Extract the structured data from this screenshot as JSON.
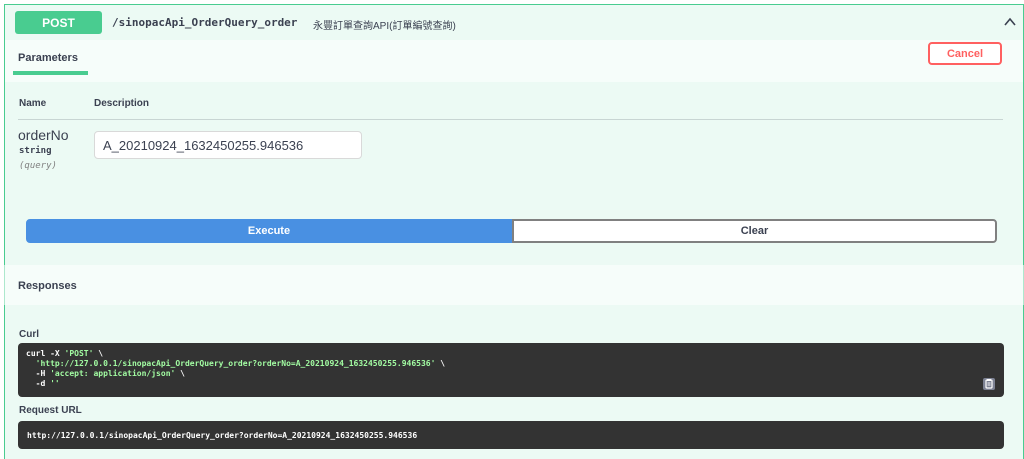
{
  "operation": {
    "method": "POST",
    "path": "/sinopacApi_OrderQuery_order",
    "description": "永豐訂單查詢API(訂單編號查詢)",
    "method_color": "#49cc90"
  },
  "tabs": {
    "parameters": "Parameters",
    "cancel": "Cancel"
  },
  "params_table": {
    "col_name": "Name",
    "col_description": "Description",
    "param": {
      "name": "orderNo",
      "type": "string",
      "in": "(query)",
      "value": "A_20210924_1632450255.946536"
    }
  },
  "actions": {
    "execute": "Execute",
    "clear": "Clear",
    "execute_color": "#4990e2"
  },
  "responses": {
    "title": "Responses",
    "curl_label": "Curl",
    "curl_lines": [
      {
        "plain": "curl -X ",
        "str": "'POST'",
        "tail": " \\"
      },
      {
        "plain": "  ",
        "str": "'http://127.0.0.1/sinopacApi_OrderQuery_order?orderNo=A_20210924_1632450255.946536'",
        "tail": " \\"
      },
      {
        "plain": "  -H ",
        "str": "'accept: application/json'",
        "tail": " \\"
      },
      {
        "plain": "  -d ",
        "str": "''",
        "tail": ""
      }
    ],
    "request_url_label": "Request URL",
    "request_url": "http://127.0.0.1/sinopacApi_OrderQuery_order?orderNo=A_20210924_1632450255.946536"
  },
  "icons": {
    "collapse": "chevron-up-icon",
    "copy": "copy-to-clipboard-icon"
  }
}
